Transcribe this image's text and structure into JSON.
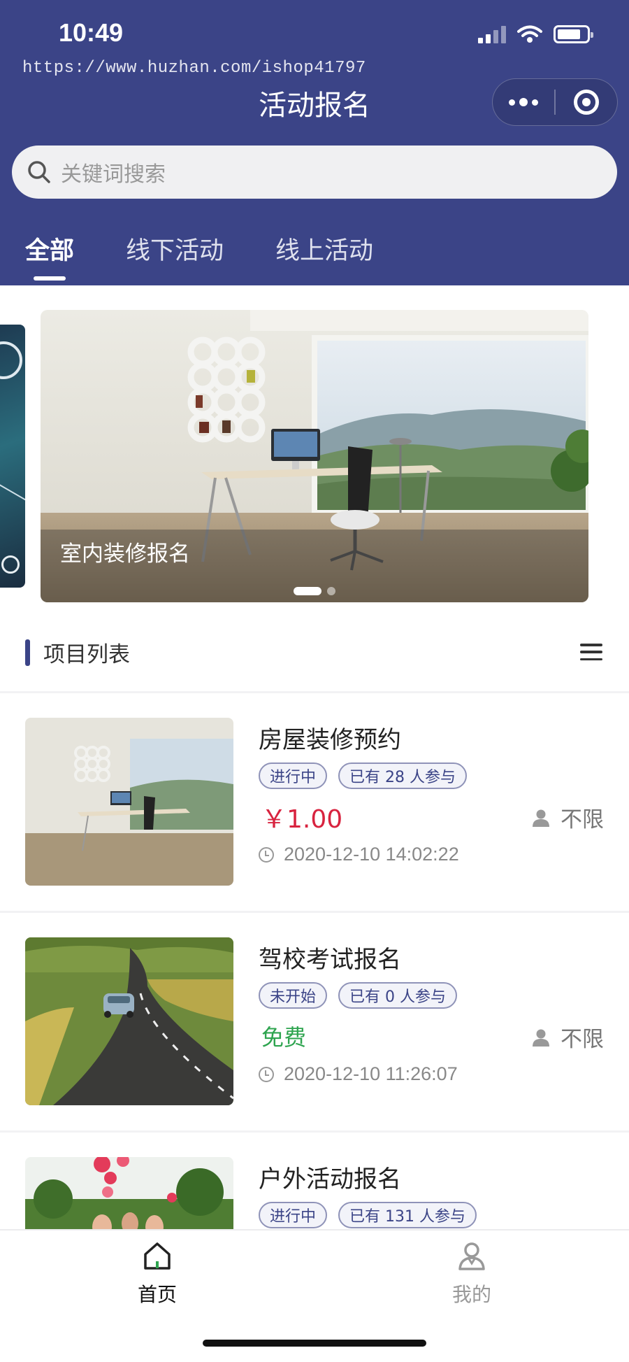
{
  "status_bar": {
    "time": "10:49"
  },
  "watermark": "https://www.huzhan.com/ishop41797",
  "nav": {
    "title": "活动报名"
  },
  "search": {
    "placeholder": "关键词搜索"
  },
  "tabs": [
    {
      "label": "全部",
      "active": true
    },
    {
      "label": "线下活动",
      "active": false
    },
    {
      "label": "线上活动",
      "active": false
    }
  ],
  "banner": {
    "caption": "室内装修报名",
    "slide_count": 2,
    "active_slide": 1
  },
  "section": {
    "title": "项目列表"
  },
  "items": [
    {
      "title": "房屋装修预约",
      "status": "进行中",
      "participants": "已有 28 人参与",
      "price": "￥1.00",
      "limit": "不限",
      "time": "2020-12-10 14:02:22"
    },
    {
      "title": "驾校考试报名",
      "status": "未开始",
      "participants": "已有 0 人参与",
      "price": "免费",
      "limit": "不限",
      "time": "2020-12-10 11:26:07"
    },
    {
      "title": "户外活动报名",
      "status": "进行中",
      "participants": "已有 131 人参与"
    }
  ],
  "tabbar": [
    {
      "label": "首页",
      "icon": "home-icon",
      "active": true
    },
    {
      "label": "我的",
      "icon": "user-icon",
      "active": false
    }
  ],
  "colors": {
    "primary": "#3b4487",
    "price_red": "#d8233f",
    "free_green": "#2ea44f"
  }
}
